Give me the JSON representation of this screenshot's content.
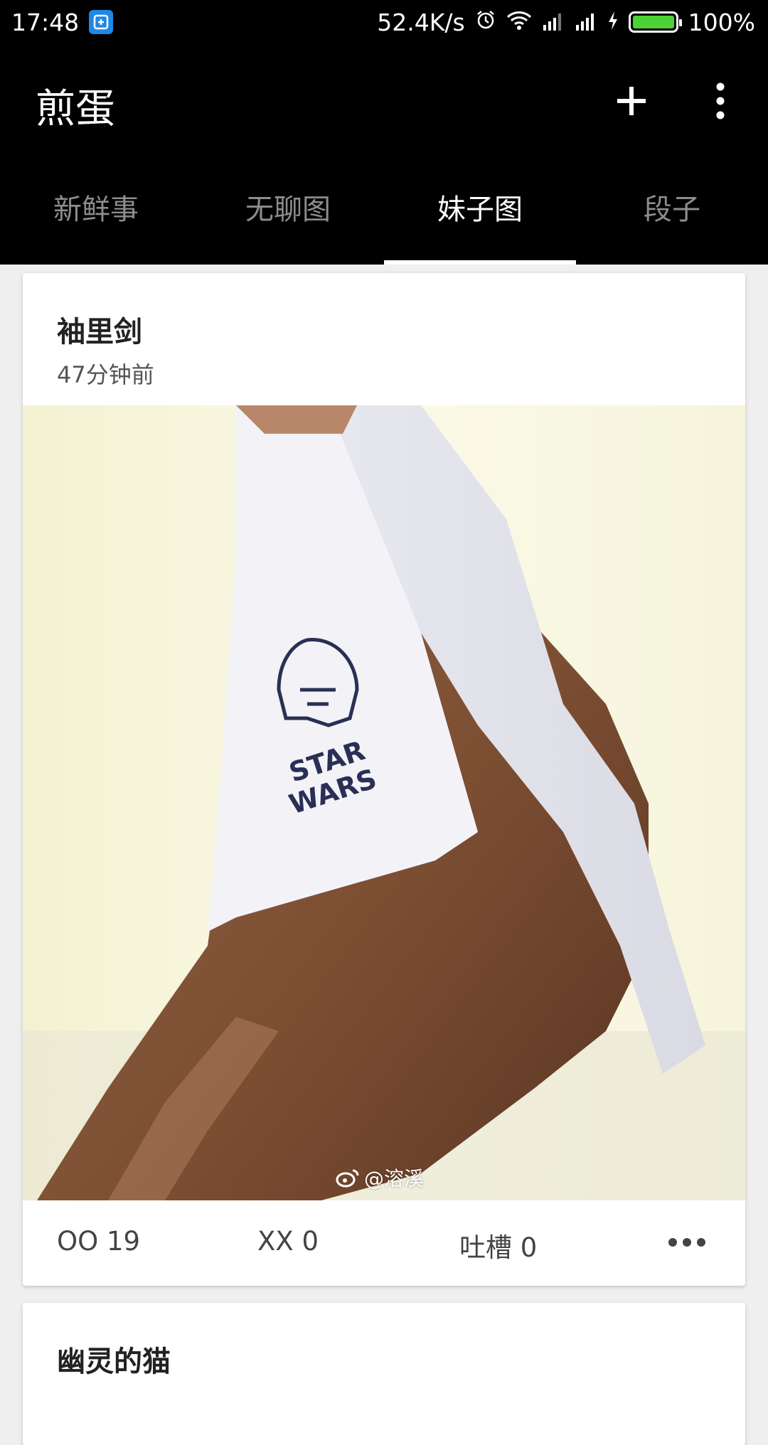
{
  "status_bar": {
    "time": "17:48",
    "net_speed": "52.4K/s",
    "battery": "100%",
    "battery_level": 1.0,
    "icons": [
      "app-badge-icon",
      "alarm-icon",
      "wifi-icon",
      "signal-icon",
      "signal-icon",
      "charging-icon",
      "battery-icon"
    ]
  },
  "app_bar": {
    "title": "煎蛋",
    "add_icon": "plus-icon",
    "more_icon": "more-vertical-icon"
  },
  "tabs": [
    {
      "label": "新鲜事",
      "active": false
    },
    {
      "label": "无聊图",
      "active": false
    },
    {
      "label": "妹子图",
      "active": true
    },
    {
      "label": "段子",
      "active": false
    }
  ],
  "posts": [
    {
      "author": "袖里剑",
      "time": "47分钟前",
      "image_watermark": "@溶溪",
      "oo": "OO 19",
      "xx": "XX 0",
      "comments": "吐槽 0",
      "more_icon": "more-horizontal-icon"
    },
    {
      "author": "幽灵的猫"
    }
  ],
  "colors": {
    "bar_bg": "#000000",
    "tab_inactive": "#8d8d8d",
    "tab_active": "#ffffff",
    "battery_fill": "#4cd137",
    "page_bg": "#efefef"
  }
}
